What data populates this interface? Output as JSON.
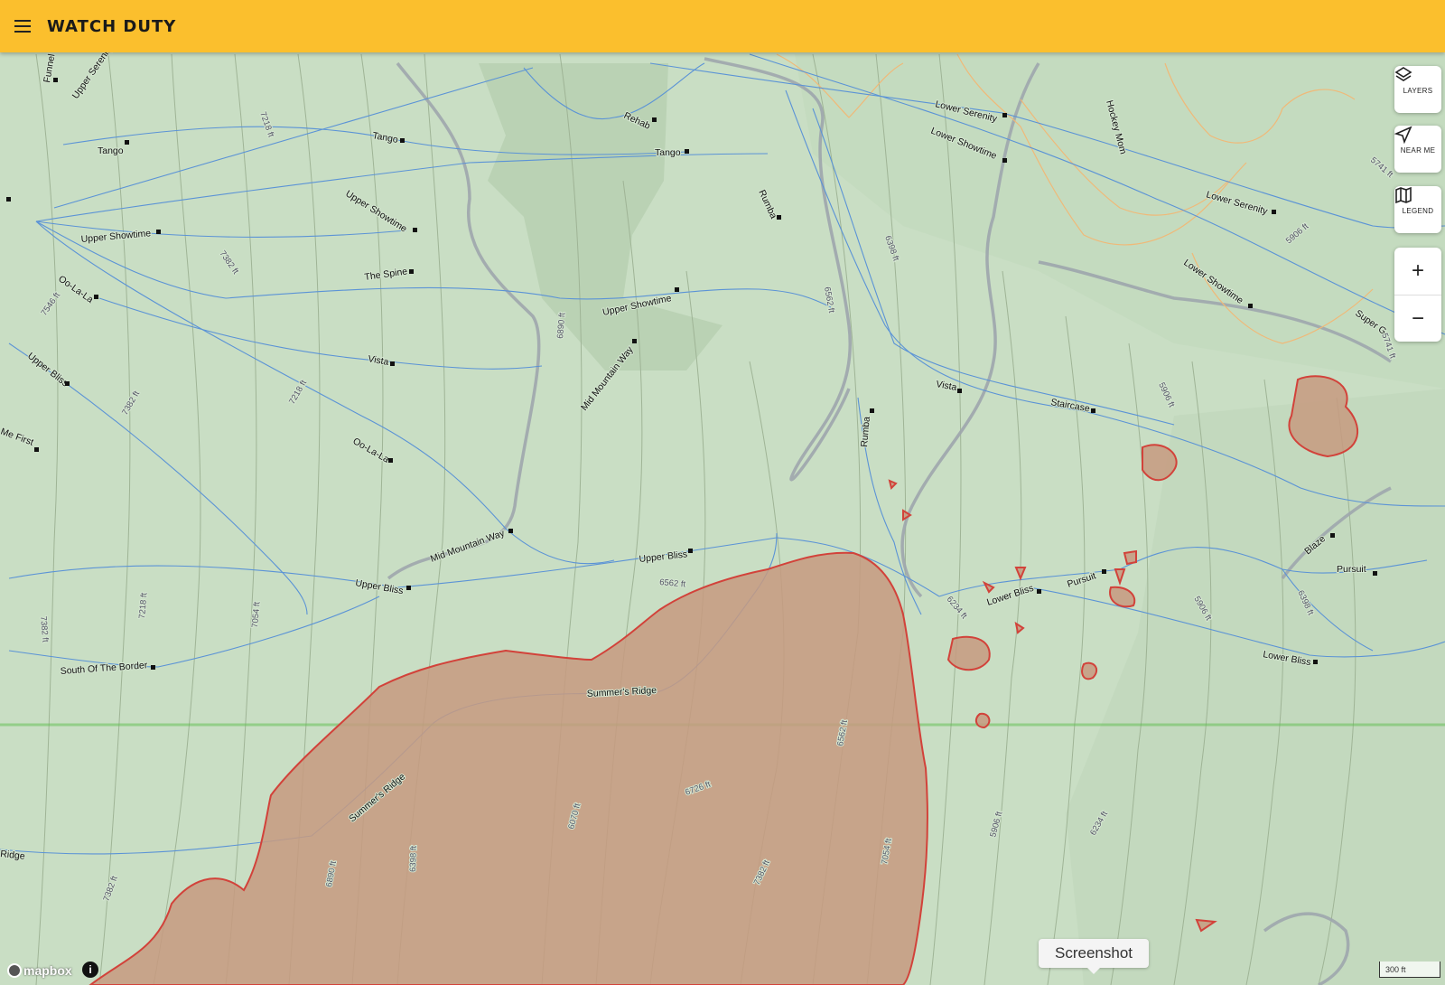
{
  "app": {
    "title": "WATCH DUTY"
  },
  "controls": {
    "layers": "LAYERS",
    "near_me": "NEAR ME",
    "legend": "LEGEND",
    "zoom_in": "+",
    "zoom_out": "−"
  },
  "tooltip": {
    "screenshot": "Screenshot"
  },
  "attribution": {
    "logo": "mapbox",
    "info": "i"
  },
  "scale_bar": {
    "label": "300 ft"
  },
  "icons": [
    "menu-icon",
    "layers-icon",
    "near-me-icon",
    "legend-icon",
    "info-icon"
  ],
  "colors": {
    "header": "#fbbf2d",
    "fire_perimeter": "#d2423a",
    "fire_fill": "#c89a80",
    "trail": "#4a90e2"
  },
  "trail_labels": [
    "Funnel",
    "Upper Serenity",
    "Tango",
    "Tango",
    "Tango",
    "Rehab",
    "Lower Serenity",
    "Lower Showtime",
    "Hockey Mom",
    "Lower Serenity",
    "Lower Showtime",
    "Rumba",
    "Upper Showtime",
    "Upper Showtime",
    "The Spine",
    "Upper Showtime",
    "Oo-La-La",
    "Vista",
    "Mid Mountain Way",
    "Vista",
    "Staircase",
    "Rumba",
    "Super G",
    "Upper Bliss",
    "Me First",
    "Oo-La-La",
    "Mid Mountain Way",
    "Upper Bliss",
    "Upper Bliss",
    "Lower Bliss",
    "Pursuit",
    "Blaze",
    "Pursuit",
    "Lower Bliss",
    "South Of The Border",
    "Summer's Ridge",
    "Summer's Ridge",
    "Ridge"
  ],
  "elevation_labels": [
    "7218 ft",
    "7382 ft",
    "7546 ft",
    "7382 ft",
    "7218 ft",
    "6890 ft",
    "6562 ft",
    "6398 ft",
    "5906 ft",
    "5741 ft",
    "5906 ft",
    "5741 ft",
    "6562 ft",
    "6234 ft",
    "7382 ft",
    "7218 ft",
    "7054 ft",
    "5906 ft",
    "6398 ft",
    "6562 ft",
    "6726 ft",
    "6070 ft",
    "5906 ft",
    "6234 ft",
    "7054 ft",
    "6890 ft",
    "6398 ft",
    "7382 ft"
  ]
}
